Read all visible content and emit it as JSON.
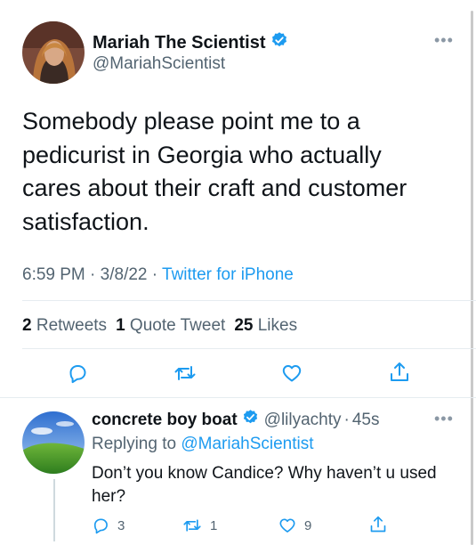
{
  "tweet": {
    "author_name": "Mariah The Scientist",
    "author_handle": "@MariahScientist",
    "text": "Somebody please point me to a pedicurist in Georgia who actually cares about their craft and customer satisfaction.",
    "time": "6:59 PM",
    "date": "3/8/22",
    "source": "Twitter for iPhone",
    "retweets_count": "2",
    "retweets_label": "Retweets",
    "quotes_count": "1",
    "quotes_label": "Quote Tweet",
    "likes_count": "25",
    "likes_label": "Likes",
    "actions": [
      "reply-icon",
      "retweet-icon",
      "like-icon",
      "share-icon"
    ]
  },
  "reply": {
    "author_name": "concrete boy boat",
    "author_handle": "@lilyachty",
    "age": "45s",
    "replying_prefix": "Replying to",
    "replying_to": "@MariahScientist",
    "text": "Don’t you know Candice? Why haven’t u used her?",
    "reply_count": "3",
    "retweet_count": "1",
    "like_count": "9"
  },
  "colors": {
    "accent": "#1d9bf0",
    "text": "#0f1419",
    "secondary": "#536471",
    "divider": "#e6ecf0"
  },
  "separator": "·"
}
